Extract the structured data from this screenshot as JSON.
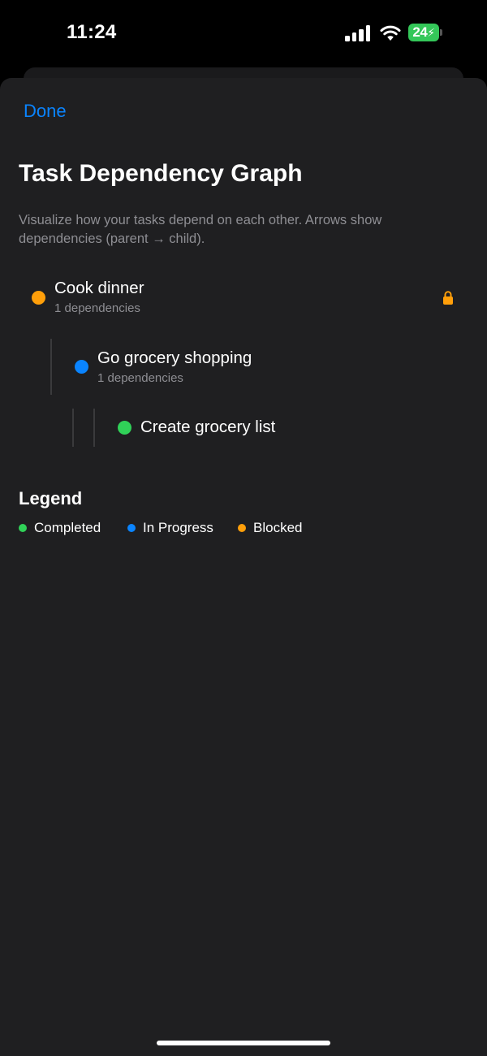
{
  "status_bar": {
    "time": "11:24",
    "battery": "24",
    "battery_color": "#34C759",
    "icons": [
      "signal-icon",
      "wifi-icon",
      "battery-charging-icon"
    ]
  },
  "nav": {
    "done_label": "Done",
    "accent_color": "#0A84FF"
  },
  "header": {
    "title": "Task Dependency Graph",
    "subtitle": "Visualize how your tasks depend on each other. Arrows show dependencies (parent → child)."
  },
  "graph": {
    "nodes": [
      {
        "title": "Cook dinner",
        "subtitle": "1 dependencies",
        "status": "Blocked",
        "color": "#FF9F0A",
        "icon": "lock-icon"
      },
      {
        "title": "Go grocery shopping",
        "subtitle": "1 dependencies",
        "status": "In Progress",
        "color": "#0A84FF"
      },
      {
        "title": "Create grocery list",
        "status": "Completed",
        "color": "#30D158"
      }
    ]
  },
  "legend": {
    "title": "Legend",
    "items": [
      {
        "label": "Completed",
        "color": "#30D158"
      },
      {
        "label": "In Progress",
        "color": "#0A84FF"
      },
      {
        "label": "Blocked",
        "color": "#FF9F0A"
      }
    ]
  }
}
